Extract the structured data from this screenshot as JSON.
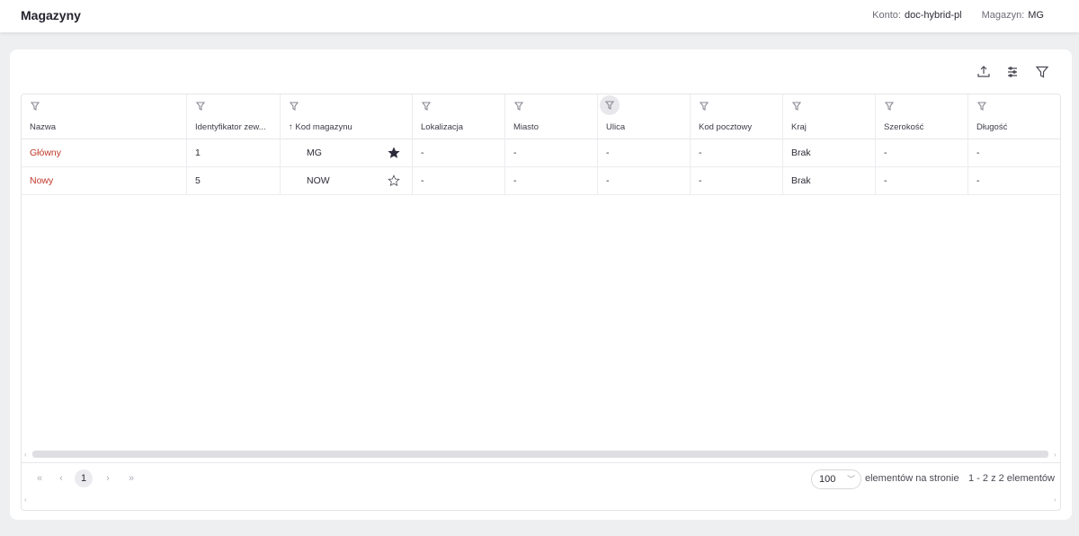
{
  "header": {
    "title": "Magazyny",
    "account_label": "Konto:",
    "account_value": "doc-hybrid-pl",
    "warehouse_label": "Magazyn:",
    "warehouse_value": "MG"
  },
  "toolbar": {
    "icons": [
      "export-icon",
      "settings-sliders-icon",
      "filter-icon"
    ]
  },
  "table": {
    "columns": [
      {
        "label": "Nazwa"
      },
      {
        "label": "Identyfikator zew..."
      },
      {
        "label": "↑ Kod magazynu"
      },
      {
        "label": "Lokalizacja"
      },
      {
        "label": "Miasto"
      },
      {
        "label": "Ulica"
      },
      {
        "label": "Kod pocztowy"
      },
      {
        "label": "Kraj"
      },
      {
        "label": "Szerokość"
      },
      {
        "label": "Długość"
      }
    ],
    "rows": [
      {
        "nazwa": "Główny",
        "id": "1",
        "kod": "MG",
        "favorite": true,
        "lokalizacja": "-",
        "miasto": "-",
        "ulica": "-",
        "kod_pocztowy": "-",
        "kraj": "Brak",
        "szerokosc": "-",
        "dlugosc": "-"
      },
      {
        "nazwa": "Nowy",
        "id": "5",
        "kod": "NOW",
        "favorite": false,
        "lokalizacja": "-",
        "miasto": "-",
        "ulica": "-",
        "kod_pocztowy": "-",
        "kraj": "Brak",
        "szerokosc": "-",
        "dlugosc": "-"
      }
    ]
  },
  "pagination": {
    "first": "«",
    "prev": "‹",
    "current_page": "1",
    "next": "›",
    "last": "»",
    "per_page": "100",
    "per_page_label": "elementów na stronie",
    "range": "1 - 2 z 2 elementów"
  },
  "colors": {
    "link": "#c0392b",
    "star_filled": "#2b2b3a"
  }
}
